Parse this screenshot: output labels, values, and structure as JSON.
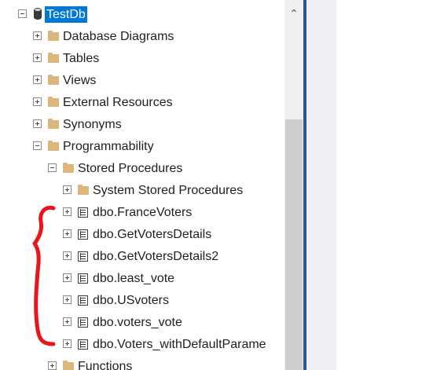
{
  "tree": {
    "database": {
      "label": "TestDb",
      "expanded": true,
      "selected": true
    },
    "items": [
      {
        "label": "Database Diagrams",
        "icon": "folder-icon",
        "expanded": false
      },
      {
        "label": "Tables",
        "icon": "folder-icon",
        "expanded": false
      },
      {
        "label": "Views",
        "icon": "folder-icon",
        "expanded": false
      },
      {
        "label": "External Resources",
        "icon": "folder-icon",
        "expanded": false
      },
      {
        "label": "Synonyms",
        "icon": "folder-icon",
        "expanded": false
      },
      {
        "label": "Programmability",
        "icon": "folder-icon",
        "expanded": true
      },
      {
        "label": "Stored Procedures",
        "icon": "folder-icon",
        "expanded": true
      },
      {
        "label": "System Stored Procedures",
        "icon": "folder-icon",
        "expanded": false
      },
      {
        "label": "dbo.FranceVoters",
        "icon": "stored-procedure-icon",
        "expanded": false
      },
      {
        "label": "dbo.GetVotersDetails",
        "icon": "stored-procedure-icon",
        "expanded": false
      },
      {
        "label": "dbo.GetVotersDetails2",
        "icon": "stored-procedure-icon",
        "expanded": false
      },
      {
        "label": "dbo.least_vote",
        "icon": "stored-procedure-icon",
        "expanded": false
      },
      {
        "label": "dbo.USvoters",
        "icon": "stored-procedure-icon",
        "expanded": false
      },
      {
        "label": "dbo.voters_vote",
        "icon": "stored-procedure-icon",
        "expanded": false
      },
      {
        "label": "dbo.Voters_withDefaultParame",
        "icon": "stored-procedure-icon",
        "expanded": false
      },
      {
        "label": "Functions",
        "icon": "folder-icon",
        "expanded": false
      }
    ]
  },
  "scrollbar": {
    "up_arrow": "⌃"
  },
  "colors": {
    "selection": "#0078d7",
    "folder": "#dcb67a",
    "annotation": "#e8151b",
    "pane_border": "#2b5797"
  }
}
